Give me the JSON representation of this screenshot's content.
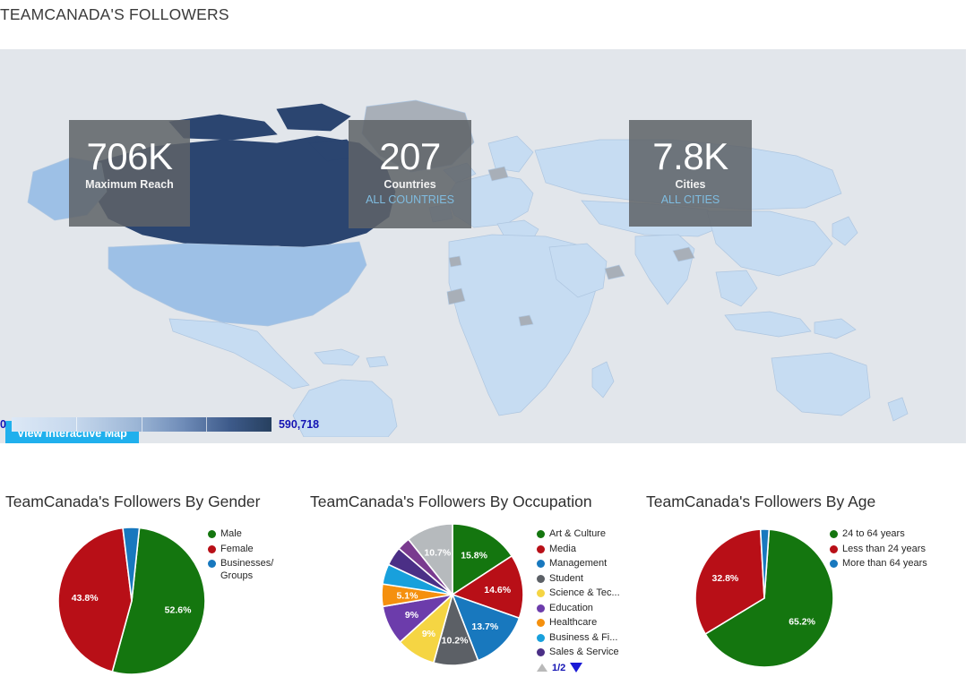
{
  "page_title": "TEAMCANADA'S FOLLOWERS",
  "map": {
    "stats": [
      {
        "value": "706K",
        "label": "Maximum Reach",
        "link": ""
      },
      {
        "value": "207",
        "label": "Countries",
        "link": "ALL COUNTRIES"
      },
      {
        "value": "7.8K",
        "label": "Cities",
        "link": "ALL CITIES"
      }
    ],
    "button_label": "View Interactive Map",
    "legend": {
      "min": "0",
      "max": "590,718"
    },
    "colors": {
      "panel_background": "#e2e6eb",
      "country_default": "#c6dcf2",
      "country_nodata": "#a8afb8",
      "country_max": "#2b4570",
      "country_mid": "#9dc0e6",
      "accent_button": "#20b0ed",
      "legend_text": "#1414b4"
    }
  },
  "charts": [
    {
      "title": "TeamCanada's Followers By Gender",
      "chart_data": {
        "type": "pie",
        "title": "TeamCanada's Followers By Gender",
        "categories": [
          "Male",
          "Female",
          "Businesses/\nGroups"
        ],
        "values": [
          52.6,
          43.8,
          3.6
        ],
        "labels": [
          "52.6%",
          "43.8%",
          ""
        ],
        "colors": [
          "#14760f",
          "#b80f17",
          "#1878be"
        ],
        "legend_position": "right",
        "unit": "%"
      },
      "pager": null
    },
    {
      "title": "TeamCanada's Followers By Occupation",
      "chart_data": {
        "type": "pie",
        "title": "TeamCanada's Followers By Occupation",
        "categories": [
          "Art & Culture",
          "Media",
          "Management",
          "Student",
          "Science & Tec...",
          "Education",
          "Healthcare",
          "Business & Fi...",
          "Sales & Service"
        ],
        "values": [
          15.8,
          14.6,
          13.7,
          10.2,
          9.0,
          9.0,
          5.1,
          4.6,
          4.3
        ],
        "labels": [
          "15.8%",
          "14.6%",
          "13.7%",
          "10.2%",
          "9%",
          "9%",
          "5.1%",
          "",
          ""
        ],
        "colors": [
          "#14760f",
          "#b80f17",
          "#1878be",
          "#5c6066",
          "#f5d543",
          "#6c3cab",
          "#f5900e",
          "#18a0dc",
          "#4b2f86"
        ],
        "extra_slices": [
          {
            "value": 3.0,
            "color": "#7a3b8f"
          },
          {
            "value": 10.7,
            "color": "#b6babd",
            "label": "10.7%"
          }
        ],
        "legend_position": "right",
        "unit": "%"
      },
      "pager": {
        "page_text": "1/2",
        "up_enabled": false,
        "down_enabled": true
      }
    },
    {
      "title": "TeamCanada's Followers By Age",
      "chart_data": {
        "type": "pie",
        "title": "TeamCanada's Followers By Age",
        "categories": [
          "24 to 64 years",
          "Less than 24 years",
          "More than 64 years"
        ],
        "values": [
          65.2,
          32.8,
          2.0
        ],
        "labels": [
          "65.2%",
          "32.8%",
          ""
        ],
        "colors": [
          "#14760f",
          "#b80f17",
          "#1878be"
        ],
        "legend_position": "right",
        "unit": "%"
      },
      "pager": null
    }
  ]
}
